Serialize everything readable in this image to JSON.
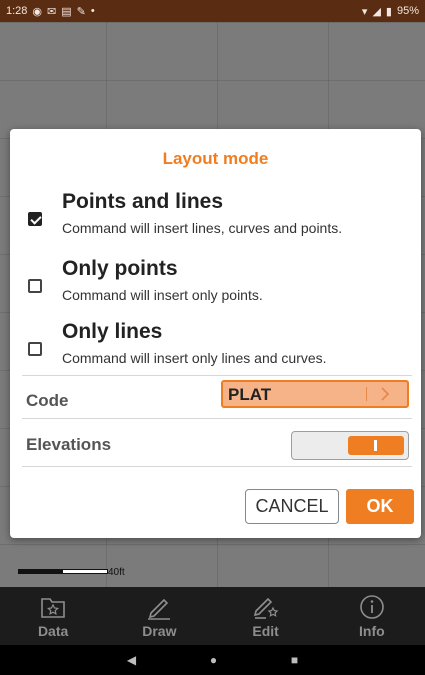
{
  "status_bar": {
    "time": "1:28",
    "notification_icons": [
      "location-icon",
      "mail-icon",
      "calendar-icon",
      "edit-icon",
      "dot-icon"
    ],
    "system_icons": [
      "wifi-icon",
      "signal-icon",
      "battery-icon"
    ],
    "battery": "95%"
  },
  "map": {
    "scale_label": "40ft"
  },
  "dialog": {
    "title": "Layout mode",
    "options": [
      {
        "title": "Points and lines",
        "description": "Command will insert lines, curves and points.",
        "checked": true
      },
      {
        "title": "Only points",
        "description": "Command will insert only points.",
        "checked": false
      },
      {
        "title": "Only lines",
        "description": "Command will insert only lines and curves.",
        "checked": false
      }
    ],
    "code": {
      "label": "Code",
      "value": "PLAT"
    },
    "elevations": {
      "label": "Elevations",
      "enabled": true
    },
    "cancel_label": "CANCEL",
    "ok_label": "OK"
  },
  "bottom_nav": {
    "items": [
      {
        "label": "Data",
        "icon": "folder-star-icon"
      },
      {
        "label": "Draw",
        "icon": "pencil-icon"
      },
      {
        "label": "Edit",
        "icon": "pencil-star-icon"
      },
      {
        "label": "Info",
        "icon": "info-icon"
      }
    ]
  },
  "colors": {
    "accent": "#ef7e22",
    "status_bar": "#5a2c12",
    "nav_bar": "#1c1c1c"
  }
}
